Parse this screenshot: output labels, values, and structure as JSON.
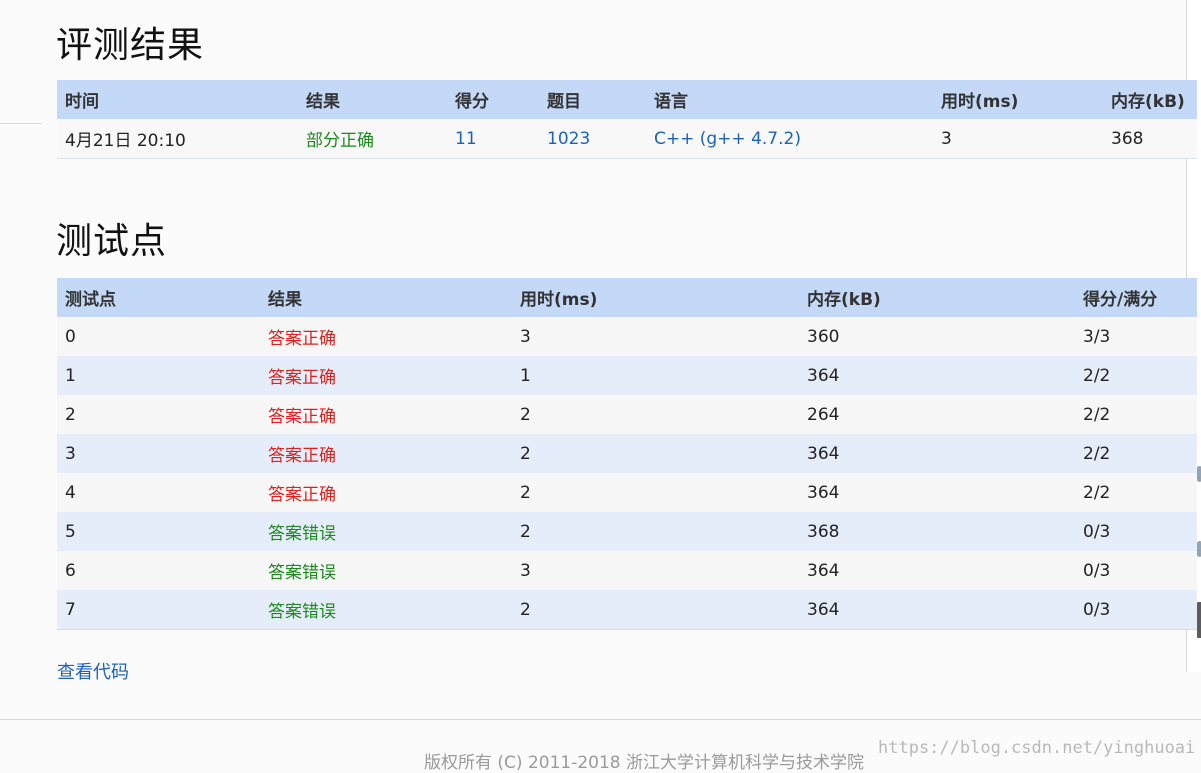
{
  "results_section": {
    "title": "评测结果",
    "headers": {
      "time": "时间",
      "result": "结果",
      "score": "得分",
      "problem": "题目",
      "language": "语言",
      "time_used": "用时(ms)",
      "memory": "内存(kB)"
    },
    "row": {
      "time": "4月21日 20:10",
      "result": "部分正确",
      "score": "11",
      "problem": "1023",
      "language": "C++ (g++ 4.7.2)",
      "time_used": "3",
      "memory": "368"
    }
  },
  "tests_section": {
    "title": "测试点",
    "headers": {
      "case": "测试点",
      "result": "结果",
      "time_used": "用时(ms)",
      "memory": "内存(kB)",
      "score": "得分/满分"
    },
    "rows": [
      {
        "case": "0",
        "result": "答案正确",
        "time_used": "3",
        "memory": "360",
        "score": "3/3"
      },
      {
        "case": "1",
        "result": "答案正确",
        "time_used": "1",
        "memory": "364",
        "score": "2/2"
      },
      {
        "case": "2",
        "result": "答案正确",
        "time_used": "2",
        "memory": "264",
        "score": "2/2"
      },
      {
        "case": "3",
        "result": "答案正确",
        "time_used": "2",
        "memory": "364",
        "score": "2/2"
      },
      {
        "case": "4",
        "result": "答案正确",
        "time_used": "2",
        "memory": "364",
        "score": "2/2"
      },
      {
        "case": "5",
        "result": "答案错误",
        "time_used": "2",
        "memory": "368",
        "score": "0/3"
      },
      {
        "case": "6",
        "result": "答案错误",
        "time_used": "3",
        "memory": "364",
        "score": "0/3"
      },
      {
        "case": "7",
        "result": "答案错误",
        "time_used": "2",
        "memory": "364",
        "score": "0/3"
      }
    ]
  },
  "view_code_label": "查看代码",
  "footer": {
    "copyright": "版权所有 (C) 2011-2018 浙江大学计算机科学与技术学院",
    "watermark": "https://blog.csdn.net/yinghuoai"
  },
  "colors": {
    "header_bg": "#c4d9f8",
    "accepted": "#e0201a",
    "wrong": "#1a8a1a",
    "partial": "#1a8a1a",
    "link": "#1c62b9"
  }
}
